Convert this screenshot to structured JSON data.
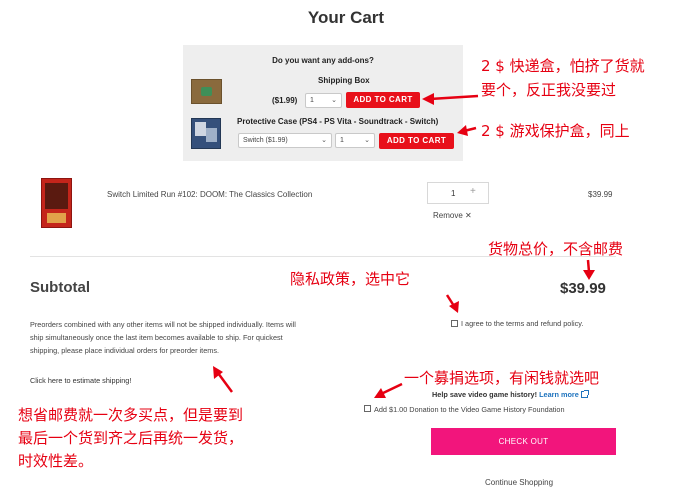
{
  "page": {
    "title": "Your Cart"
  },
  "addons": {
    "question": "Do you want any add-ons?",
    "shipping_box": {
      "name": "Shipping Box",
      "price": "($1.99)",
      "qty": "1",
      "button": "ADD TO CART"
    },
    "protective_case": {
      "name": "Protective Case (PS4 - PS Vita - Soundtrack - Switch)",
      "variant": "Switch ($1.99)",
      "qty": "1",
      "button": "ADD TO CART"
    }
  },
  "cart_item": {
    "name": "Switch Limited Run #102: DOOM: The Classics Collection",
    "qty": "1",
    "plus": "+",
    "remove": "Remove ✕",
    "price": "$39.99"
  },
  "summary": {
    "subtotal_label": "Subtotal",
    "subtotal_price": "$39.99",
    "note": "Preorders combined with any other items will not be shipped individually. Items will ship simultaneously once the last item becomes available to ship. For quickest shipping, please place individual orders for preorder items.",
    "estimate_link": "Click here to estimate shipping!",
    "terms": "I agree to the terms and refund policy.",
    "vgh_prompt": "Help save video game history!",
    "vgh_link": "Learn more",
    "donation": "Add $1.00 Donation to the Video Game History Foundation",
    "checkout": "CHECK OUT",
    "continue": "Continue Shopping"
  },
  "annotations": {
    "addon_box_line1": "2 $ 快递盒，怕挤了货就",
    "addon_box_line2": "要个，反正我没要过",
    "addon_case": "2 $ 游戏保护盒，同上",
    "total_note": "货物总价，不含邮费",
    "privacy_note": "隐私政策，选中它",
    "donation_note": "一个募捐选项，有闲钱就选吧",
    "shipping_line1": "想省邮费就一次多买点，但是要到",
    "shipping_line2": "最后一个货到齐之后再统一发货，",
    "shipping_line3": "时效性差。"
  },
  "colors": {
    "add_to_cart": "#e8101a",
    "checkout": "#f2157c",
    "annotation": "#e60012",
    "link": "#1e73be",
    "addon_panel": "#eeeeee"
  }
}
